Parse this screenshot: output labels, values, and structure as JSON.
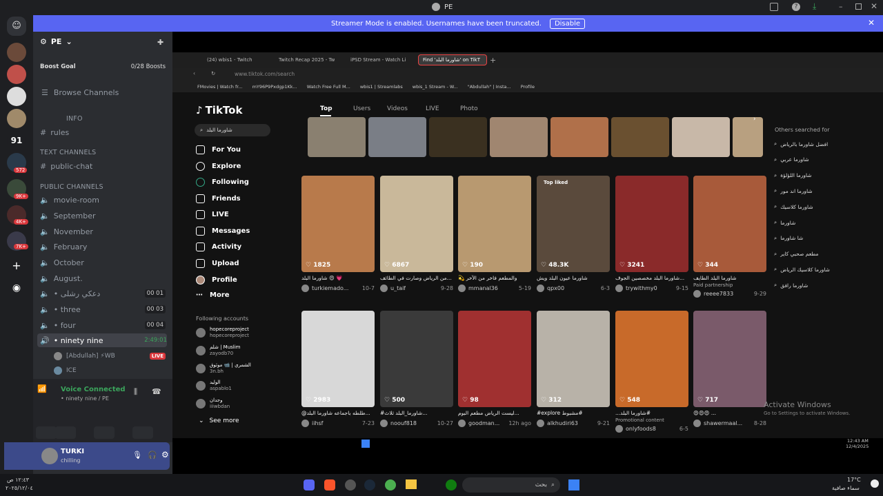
{
  "window": {
    "title": "PE"
  },
  "banner": {
    "text": "Streamer Mode is enabled. Usernames have been truncated.",
    "button": "Disable"
  },
  "rail": {
    "badges": [
      "91",
      "572",
      "9K+",
      "4K+",
      "7K+"
    ]
  },
  "server": {
    "name": "PE",
    "boost_goal": "Boost Goal",
    "boost_count": "0/28 Boosts",
    "browse": "Browse Channels",
    "info_header": "INFO",
    "rules": "rules",
    "text_cat": "TEXT CHANNELS",
    "public_chat": "public-chat",
    "public_cat": "PUBLIC CHANNELS",
    "voice": [
      {
        "name": "movie-room"
      },
      {
        "name": "September"
      },
      {
        "name": "November"
      },
      {
        "name": "February"
      },
      {
        "name": "October"
      },
      {
        "name": "August."
      }
    ],
    "voice2": [
      {
        "name": "• دعكي رشلى",
        "count": "00 01"
      },
      {
        "name": "• three",
        "count": "00 03"
      },
      {
        "name": "• four",
        "count": "00 04"
      },
      {
        "name": "• ninety nine",
        "count": "2:49:01"
      }
    ],
    "users": [
      {
        "name": "[Abdullah] ⚡WB",
        "badge": "LIVE"
      },
      {
        "name": "ICE",
        "badge": ""
      }
    ],
    "voice_status": "Voice Connected",
    "voice_sub": "• ninety nine / PE",
    "user_name": "TURKI",
    "user_status": "chilling"
  },
  "browser": {
    "tabs": [
      "(24) wbis1 - Twitch",
      "Twitch Recap 2025 - Tw",
      "iPSD Stream - Watch Li",
      "Find 'شاورما البلد' on TikT"
    ],
    "url": "www.tiktok.com/search",
    "bookmarks": [
      "FMovies | Watch fr...",
      "mY96P9Pxdgp1Kk...",
      "Watch Free Full M...",
      "wbis1 | Streamlabs",
      "wbis_1 Stream - W...",
      "\"Abdullah\" | Insta...",
      "Profile"
    ]
  },
  "tiktok": {
    "logo": "TikTok",
    "search": "شاورما البلد",
    "nav": [
      "For You",
      "Explore",
      "Following",
      "Friends",
      "LIVE",
      "Messages",
      "Activity",
      "Upload",
      "Profile",
      "More"
    ],
    "following_header": "Following accounts",
    "following": [
      {
        "name": "hopecoreproject",
        "sub": "hopecoreproject"
      },
      {
        "name": "شلم | Muslim",
        "sub": "zayodb70"
      },
      {
        "name": "الشمري | 📹 موثوق",
        "sub": "3n.bh"
      },
      {
        "name": "الوليد",
        "sub": "aspablo1"
      },
      {
        "name": "وجدان",
        "sub": "iiiwbdan"
      }
    ],
    "see_more": "See more",
    "tabs": [
      "Top",
      "Users",
      "Videos",
      "LIVE",
      "Photo"
    ],
    "others_header": "Others searched for",
    "others": [
      "افضل شاورما بالرياض",
      "شاورما عربي",
      "شاورما اللؤلؤة",
      "شاورما اند مور",
      "شاورما كلاسيك",
      "شاورما",
      "شا شاورما",
      "مطعم صحبي كاير",
      "شاورما كلاسيك الرياض",
      "شاورما رافق"
    ],
    "videos": [
      {
        "likes": "1825",
        "cap": "شاورما البلد 😍 💗",
        "user": "turkiemado...",
        "date": "10-7",
        "color": "#b87a4b"
      },
      {
        "likes": "6867",
        "cap": "من الرياض وصارت في الطائف...",
        "user": "u_taif",
        "date": "9-28",
        "color": "#c9b89a"
      },
      {
        "likes": "190",
        "cap": "💫 والمطعم فاخر من الآخر",
        "user": "mmanal36",
        "date": "5-19",
        "color": "#b89970"
      },
      {
        "likes": "48.3K",
        "cap": "شاورما عيون البلد ويش",
        "user": "qpx00",
        "date": "6-3",
        "color": "#5a4a3c",
        "tag": "Top liked"
      },
      {
        "likes": "3241",
        "cap": "شاورما البلد مخصصين الجوف...",
        "user": "trywithmy0",
        "date": "9-15",
        "color": "#8a2a2a"
      },
      {
        "likes": "344",
        "cap": "شاورما البلد الطايف",
        "user": "reeee7833",
        "date": "9-29",
        "color": "#a85a3a",
        "sub": "Paid partnership"
      },
      {
        "likes": "2983",
        "cap": "@طلطه باجماعه شاورما البلد...",
        "user": "iihsf",
        "date": "7-23",
        "color": "#d8d8d8"
      },
      {
        "likes": "500",
        "cap": "#شاورما_البلد ثلاث...",
        "user": "noouf818",
        "date": "10-27",
        "color": "#3a3a3a"
      },
      {
        "likes": "98",
        "cap": "ليست الرياض مطعم البوم...",
        "user": "goodman...",
        "date": "12h ago",
        "color": "#a03030"
      },
      {
        "likes": "312",
        "cap": "#explore مشبوط#",
        "user": "alkhudiri63",
        "date": "9-21",
        "color": "#b8b2a8"
      },
      {
        "likes": "548",
        "cap": "...شاورما البلد#",
        "user": "onlyfoods8",
        "date": "6-5",
        "color": "#c86a2a",
        "sub": "Promotional content"
      },
      {
        "likes": "717",
        "cap": "😍😍😍 ...",
        "user": "shawermaal...",
        "date": "8-28",
        "color": "#7a5a6a"
      }
    ]
  },
  "activation": {
    "title": "Activate Windows",
    "sub": "Go to Settings to activate Windows."
  },
  "clock": {
    "time": "12:43 AM",
    "date": "12/4/2025"
  },
  "taskbar": {
    "search": "بحث",
    "weather": "17°C",
    "weather_sub": "سماء صافية",
    "time": "١٢:٤٣ ص",
    "date": "٢٠٢٥/١٢/٠٤"
  }
}
